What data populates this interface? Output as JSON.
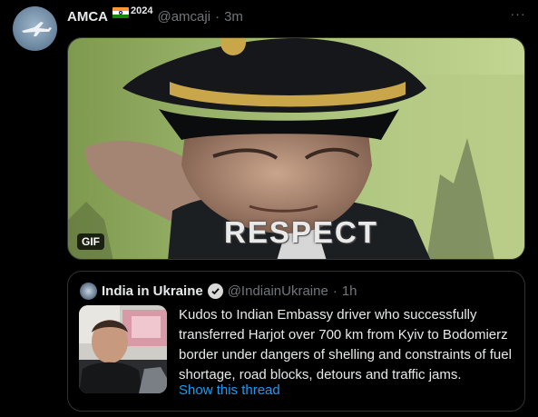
{
  "tweet": {
    "display_name": "AMCA",
    "name_suffix": "2024",
    "handle": "@amcaji",
    "separator": "·",
    "time": "3m",
    "more_label": "···"
  },
  "media": {
    "badge": "GIF",
    "caption": "RESPECT"
  },
  "quote": {
    "display_name": "India in Ukraine",
    "handle": "@IndiainUkraine",
    "separator": "·",
    "time": "1h",
    "text": "Kudos to Indian Embassy driver who successfully transferred Harjot over 700 km from Kyiv to Bodomierz border under dangers of shelling and constraints of fuel shortage, road blocks, detours and traffic jams.",
    "show_thread": "Show this thread"
  },
  "colors": {
    "background": "#000000",
    "text": "#e7e9ea",
    "muted": "#71767b",
    "link": "#1d9bf0",
    "border": "#2f3336"
  }
}
